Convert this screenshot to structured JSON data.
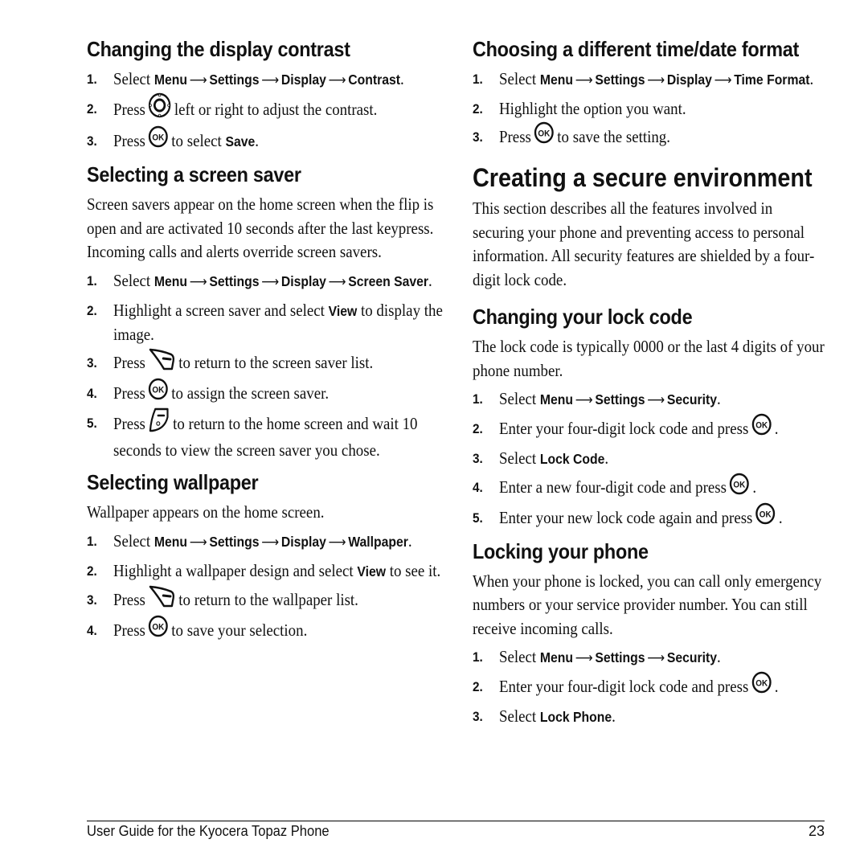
{
  "left": {
    "contrast": {
      "heading": "Changing the display contrast",
      "steps": [
        {
          "num": "1.",
          "pre": "Select ",
          "path": [
            "Menu",
            "Settings",
            "Display",
            "Contrast"
          ],
          "post": "."
        },
        {
          "num": "2.",
          "pre": "Press",
          "icon": "nav-key",
          "post": "left or right to adjust the contrast."
        },
        {
          "num": "3.",
          "pre": "Press",
          "icon": "ok-key",
          "mid": "to select ",
          "bold": "Save",
          "post": "."
        }
      ]
    },
    "screensaver": {
      "heading": "Selecting a screen saver",
      "body": "Screen savers appear on the home screen when the flip is open and are activated 10 seconds after the last keypress. Incoming calls and alerts override screen savers.",
      "steps": [
        {
          "num": "1.",
          "pre": "Select ",
          "path": [
            "Menu",
            "Settings",
            "Display",
            "Screen Saver"
          ],
          "post": "."
        },
        {
          "num": "2.",
          "pre": "Highlight a screen saver and select ",
          "bold": "View",
          "post": " to display the image."
        },
        {
          "num": "3.",
          "pre": "Press",
          "icon": "back-key",
          "post": "to return to the screen saver list."
        },
        {
          "num": "4.",
          "pre": "Press",
          "icon": "ok-key",
          "post": "to assign the screen saver."
        },
        {
          "num": "5.",
          "pre": "Press",
          "icon": "end-key",
          "post": "to return to the home screen and wait 10 seconds to view the screen saver you chose."
        }
      ]
    },
    "wallpaper": {
      "heading": "Selecting wallpaper",
      "body": "Wallpaper appears on the home screen.",
      "steps": [
        {
          "num": "1.",
          "pre": "Select ",
          "path": [
            "Menu",
            "Settings",
            "Display",
            "Wallpaper"
          ],
          "post": "."
        },
        {
          "num": "2.",
          "pre": "Highlight a wallpaper design and select ",
          "bold": "View",
          "post": " to see it."
        },
        {
          "num": "3.",
          "pre": "Press",
          "icon": "back-key",
          "post": "to return to the wallpaper list."
        },
        {
          "num": "4.",
          "pre": "Press",
          "icon": "ok-key",
          "post": "to save your selection."
        }
      ]
    }
  },
  "right": {
    "timeformat": {
      "heading": "Choosing a different time/date format",
      "steps": [
        {
          "num": "1.",
          "pre": "Select ",
          "path": [
            "Menu",
            "Settings",
            "Display",
            "Time Format"
          ],
          "post": "."
        },
        {
          "num": "2.",
          "pre": "Highlight the option you want."
        },
        {
          "num": "3.",
          "pre": "Press",
          "icon": "ok-key",
          "post": "to save the setting."
        }
      ]
    },
    "secure": {
      "title": "Creating a secure environment",
      "body": "This section describes all the features involved in securing your phone and preventing access to personal information. All security features are shielded by a four-digit lock code."
    },
    "lockcode": {
      "heading": "Changing your lock code",
      "body": "The lock code is typically 0000 or the last 4 digits of your phone number.",
      "steps": [
        {
          "num": "1.",
          "pre": "Select ",
          "path": [
            "Menu",
            "Settings",
            "Security"
          ],
          "post": "."
        },
        {
          "num": "2.",
          "pre": "Enter your four-digit lock code and press",
          "icon": "ok-key",
          "post": "."
        },
        {
          "num": "3.",
          "pre": "Select ",
          "bold": "Lock Code",
          "post": "."
        },
        {
          "num": "4.",
          "pre": "Enter a new four-digit code and press",
          "icon": "ok-key",
          "post": "."
        },
        {
          "num": "5.",
          "pre": "Enter your new lock code again and press",
          "icon": "ok-key",
          "post": "."
        }
      ]
    },
    "lockphone": {
      "heading": "Locking your phone",
      "body": "When your phone is locked, you can call only emergency numbers or your service provider number. You can still receive incoming calls.",
      "steps": [
        {
          "num": "1.",
          "pre": "Select ",
          "path": [
            "Menu",
            "Settings",
            "Security"
          ],
          "post": "."
        },
        {
          "num": "2.",
          "pre": "Enter your four-digit lock code and press",
          "icon": "ok-key",
          "post": "."
        },
        {
          "num": "3.",
          "pre": "Select ",
          "bold": "Lock Phone",
          "post": "."
        }
      ]
    }
  },
  "footer": {
    "title": "User Guide for the Kyocera Topaz Phone",
    "page_number": "23"
  },
  "symbols": {
    "arrow": "⟶"
  }
}
